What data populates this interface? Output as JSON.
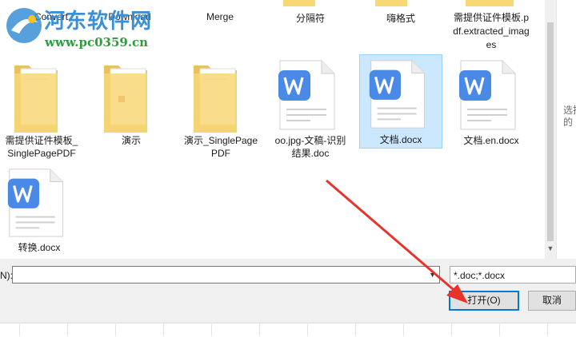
{
  "top_row": [
    {
      "label": "Convert"
    },
    {
      "label": "Download"
    },
    {
      "label": "Merge"
    },
    {
      "label": "分隔符"
    },
    {
      "label": "嗨格式"
    },
    {
      "label": "需提供证件模板.pdf.extracted_images"
    }
  ],
  "row2": [
    {
      "label": "需提供证件模板_SinglePagePDF",
      "type": "folder-docs"
    },
    {
      "label": "演示",
      "type": "folder-red"
    },
    {
      "label": "演示_SinglePagePDF",
      "type": "folder-docs"
    },
    {
      "label": "oo.jpg-文稿-识别结果.doc",
      "type": "wps-doc"
    },
    {
      "label": "文档.docx",
      "type": "wps-doc",
      "selected": true
    },
    {
      "label": "文档.en.docx",
      "type": "wps-doc"
    }
  ],
  "row3": [
    {
      "label": "转换.docx",
      "type": "wps-doc"
    }
  ],
  "preview_text": "选择 的",
  "bottom": {
    "name_label": "N):",
    "name_value": "",
    "filter_value": "*.doc;*.docx",
    "open_label": "打开(O)",
    "cancel_label": "取消"
  },
  "watermark": {
    "title": "河东软件网",
    "url": "www.pc0359.cn"
  },
  "colors": {
    "selection_bg": "#cce8ff",
    "wps_blue": "#4a89e6",
    "folder_yellow": "#f8d775",
    "arrow_red": "#e8332a",
    "open_button_border": "#0078d7"
  }
}
